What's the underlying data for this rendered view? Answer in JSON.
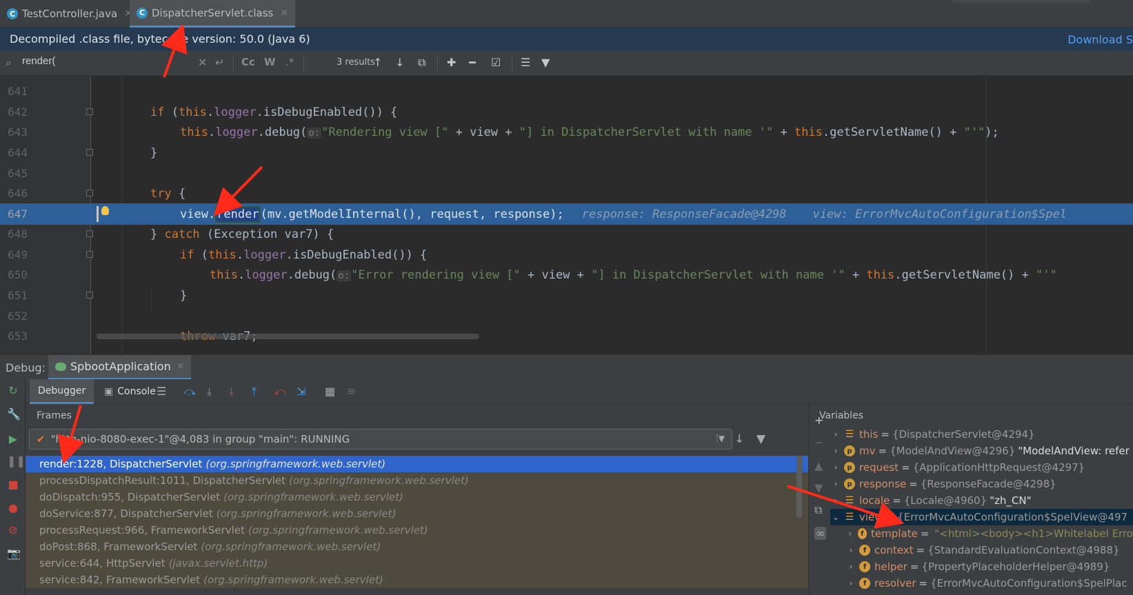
{
  "tabs": [
    {
      "label": "TestController.java",
      "icon": "C",
      "active": false
    },
    {
      "label": "DispatcherServlet.class",
      "icon": "C",
      "active": true
    }
  ],
  "banner": {
    "text": "Decompiled .class file, bytecode version: 50.0 (Java 6)",
    "link": "Download S"
  },
  "search": {
    "value": "render(",
    "results": "3 results",
    "case_label": "Cc",
    "word_label": "W",
    "regex_label": ".*"
  },
  "editor": {
    "lines": [
      {
        "num": "641"
      },
      {
        "num": "642"
      },
      {
        "num": "643"
      },
      {
        "num": "644"
      },
      {
        "num": "645"
      },
      {
        "num": "646"
      },
      {
        "num": "647"
      },
      {
        "num": "648"
      },
      {
        "num": "649"
      },
      {
        "num": "650"
      },
      {
        "num": "651"
      },
      {
        "num": "652"
      },
      {
        "num": "653"
      }
    ],
    "code": {
      "l642_kw": "if",
      "l642_a": " (",
      "l642_this": "this",
      "l642_dot": ".",
      "l642_fld": "logger",
      "l642_b": ".isDebugEnabled()) {",
      "l643_this": "this",
      "l643_dot": ".",
      "l643_fld": "logger",
      "l643_a": ".debug(",
      "l643_hint": "o:",
      "l643_s1": "\"Rendering view [\"",
      "l643_b": " + view + ",
      "l643_s2": "\"] in DispatcherServlet with name '\"",
      "l643_c": " + ",
      "l643_this2": "this",
      "l643_d": ".getServletName() + ",
      "l643_s3": "\"'\"",
      "l643_e": ");",
      "l644": "}",
      "l646_kw": "try",
      "l646_a": " {",
      "l647_a": "view.",
      "l647_match": "render",
      "l647_b": "(mv.getModelInternal(), request, response);",
      "l647_inl1": "response: ResponseFacade@4298",
      "l647_inl2": "view: ErrorMvcAutoConfiguration$Spel",
      "l648_a": "} ",
      "l648_kw": "catch",
      "l648_b": " (Exception var7) {",
      "l649_kw": "if",
      "l649_a": " (",
      "l649_this": "this",
      "l649_dot": ".",
      "l649_fld": "logger",
      "l649_b": ".isDebugEnabled()) {",
      "l650_this": "this",
      "l650_dot": ".",
      "l650_fld": "logger",
      "l650_a": ".debug(",
      "l650_hint": "o:",
      "l650_s1": "\"Error rendering view [\"",
      "l650_b": " + view + ",
      "l650_s2": "\"] in DispatcherServlet with name '\"",
      "l650_c": " + ",
      "l650_this2": "this",
      "l650_d": ".getServletName() + ",
      "l650_s3": "\"'\"",
      "l651": "}",
      "l653_kw": "throw",
      "l653_a": " var7;"
    }
  },
  "debug": {
    "label": "Debug:",
    "session": "SpbootApplication",
    "tab_debugger": "Debugger",
    "tab_console": "Console"
  },
  "frames": {
    "title": "Frames",
    "thread": "\"http-nio-8080-exec-1\"@4,083 in group \"main\": RUNNING",
    "items": [
      {
        "method": "render:1228, DispatcherServlet",
        "pkg": "(org.springframework.web.servlet)"
      },
      {
        "method": "processDispatchResult:1011, DispatcherServlet",
        "pkg": "(org.springframework.web.servlet)"
      },
      {
        "method": "doDispatch:955, DispatcherServlet",
        "pkg": "(org.springframework.web.servlet)"
      },
      {
        "method": "doService:877, DispatcherServlet",
        "pkg": "(org.springframework.web.servlet)"
      },
      {
        "method": "processRequest:966, FrameworkServlet",
        "pkg": "(org.springframework.web.servlet)"
      },
      {
        "method": "doPost:868, FrameworkServlet",
        "pkg": "(org.springframework.web.servlet)"
      },
      {
        "method": "service:644, HttpServlet",
        "pkg": "(javax.servlet.http)"
      },
      {
        "method": "service:842, FrameworkServlet",
        "pkg": "(org.springframework.web.servlet)"
      }
    ]
  },
  "variables": {
    "title": "Variables",
    "items": [
      {
        "exp": "›",
        "icon": "list",
        "name": "this",
        "value": "{DispatcherServlet@4294}",
        "extra": ""
      },
      {
        "exp": "›",
        "icon": "p",
        "name": "mv",
        "value": "{ModelAndView@4296}",
        "extra": "\"ModelAndView: refer"
      },
      {
        "exp": "›",
        "icon": "p",
        "name": "request",
        "value": "{ApplicationHttpRequest@4297}",
        "extra": ""
      },
      {
        "exp": "›",
        "icon": "p",
        "name": "response",
        "value": "{ResponseFacade@4298}",
        "extra": ""
      },
      {
        "exp": "›",
        "icon": "list",
        "name": "locale",
        "value": "{Locale@4960}",
        "extra": "\"zh_CN\""
      },
      {
        "exp": "⌄",
        "icon": "list",
        "name": "view",
        "value": "{ErrorMvcAutoConfiguration$SpelView@497",
        "extra": ""
      },
      {
        "exp": "›",
        "icon": "f",
        "name": "template",
        "value": "",
        "extra2": "\"<html><body><h1>Whitelabel Erro"
      },
      {
        "exp": "›",
        "icon": "f",
        "name": "context",
        "value": "{StandardEvaluationContext@4988}",
        "extra": ""
      },
      {
        "exp": "›",
        "icon": "f",
        "name": "helper",
        "value": "{PropertyPlaceholderHelper@4989}",
        "extra": ""
      },
      {
        "exp": "›",
        "icon": "f",
        "name": "resolver",
        "value": "{ErrorMvcAutoConfiguration$SpelPlac",
        "extra": ""
      }
    ]
  },
  "colors": {
    "accent": "#4a88c7",
    "selection": "#2f65ca",
    "current_line": "#2d6099",
    "annotation_arrow": "#ff2a1a"
  }
}
